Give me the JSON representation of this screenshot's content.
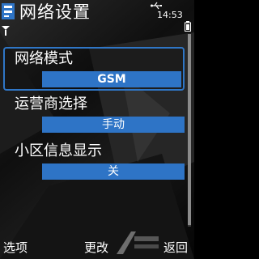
{
  "header": {
    "title": "网络设置",
    "clock": "14:53"
  },
  "settings": [
    {
      "label": "网络模式",
      "value": "GSM",
      "selected": true
    },
    {
      "label": "运营商选择",
      "value": "手动",
      "selected": false
    },
    {
      "label": "小区信息显示",
      "value": "关",
      "selected": false
    }
  ],
  "softkeys": {
    "left": "选项",
    "middle": "更改",
    "right": "返回"
  },
  "colors": {
    "accent": "#2e74c6",
    "selection_border": "#2f76c6"
  },
  "icons": [
    "network-logo-icon",
    "usb-icon",
    "battery-icon",
    "signal-icon"
  ]
}
